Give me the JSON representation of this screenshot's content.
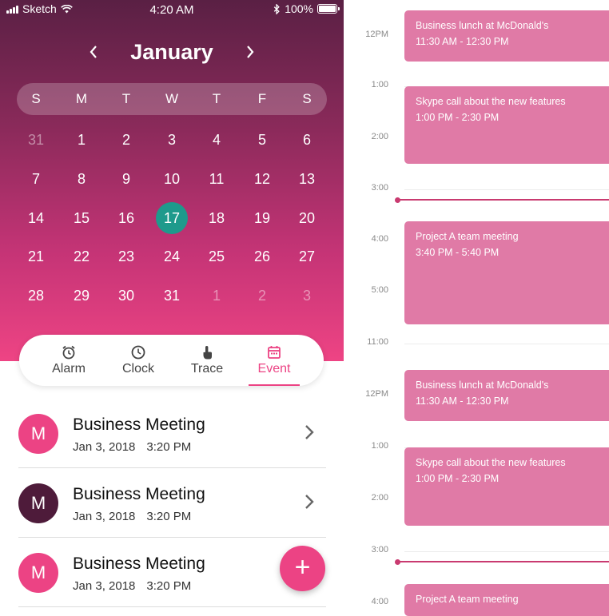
{
  "status_bar": {
    "carrier": "Sketch",
    "time": "4:20 AM",
    "battery": "100%"
  },
  "calendar": {
    "month": "January",
    "weekdays": [
      "S",
      "M",
      "T",
      "W",
      "T",
      "F",
      "S"
    ],
    "weeks": [
      [
        {
          "d": "31",
          "muted": true
        },
        {
          "d": "1"
        },
        {
          "d": "2"
        },
        {
          "d": "3"
        },
        {
          "d": "4"
        },
        {
          "d": "5"
        },
        {
          "d": "6"
        }
      ],
      [
        {
          "d": "7"
        },
        {
          "d": "8"
        },
        {
          "d": "9"
        },
        {
          "d": "10"
        },
        {
          "d": "11"
        },
        {
          "d": "12"
        },
        {
          "d": "13"
        }
      ],
      [
        {
          "d": "14"
        },
        {
          "d": "15"
        },
        {
          "d": "16"
        },
        {
          "d": "17",
          "selected": true
        },
        {
          "d": "18"
        },
        {
          "d": "19"
        },
        {
          "d": "20"
        }
      ],
      [
        {
          "d": "21"
        },
        {
          "d": "22"
        },
        {
          "d": "23"
        },
        {
          "d": "24"
        },
        {
          "d": "25"
        },
        {
          "d": "26"
        },
        {
          "d": "27"
        }
      ],
      [
        {
          "d": "28"
        },
        {
          "d": "29"
        },
        {
          "d": "30"
        },
        {
          "d": "31"
        },
        {
          "d": "1",
          "muted": true
        },
        {
          "d": "2",
          "muted": true
        },
        {
          "d": "3",
          "muted": true
        }
      ]
    ],
    "selected_color": "#1e9a8c"
  },
  "tabs": [
    {
      "label": "Alarm",
      "icon": "alarm-icon"
    },
    {
      "label": "Clock",
      "icon": "clock-icon"
    },
    {
      "label": "Trace",
      "icon": "touch-icon"
    },
    {
      "label": "Event",
      "icon": "calendar-icon",
      "active": true
    }
  ],
  "events_list": [
    {
      "initial": "M",
      "title": "Business Meeting",
      "date": "Jan 3, 2018",
      "time": "3:20 PM",
      "color": "#ec4384",
      "chevron": true
    },
    {
      "initial": "M",
      "title": "Business Meeting",
      "date": "Jan 3, 2018",
      "time": "3:20 PM",
      "color": "#4e1b3a",
      "chevron": true
    },
    {
      "initial": "M",
      "title": "Business Meeting",
      "date": "Jan 3, 2018",
      "time": "3:20 PM",
      "color": "#ec4384",
      "chevron": false
    }
  ],
  "fab": {
    "label": "+"
  },
  "timeline": {
    "hours": [
      "12PM",
      "1:00",
      "2:00",
      "3:00",
      "4:00",
      "5:00",
      "11:00",
      "12PM",
      "1:00",
      "2:00",
      "3:00",
      "4:00"
    ],
    "events": [
      {
        "title": "Business lunch at McDonald's",
        "time": "11:30 AM - 12:30 PM"
      },
      {
        "title": "Skype call about the new features",
        "time": "1:00 PM - 2:30 PM"
      },
      {
        "title": "Project A team meeting",
        "time": "3:40 PM - 5:40 PM"
      },
      {
        "title": "Business lunch at McDonald's",
        "time": "11:30 AM - 12:30 PM"
      },
      {
        "title": "Skype call about the new features",
        "time": "1:00 PM - 2:30 PM"
      },
      {
        "title": "Project A team meeting",
        "time": ""
      }
    ],
    "accent": "#c93a70",
    "event_color": "#e07aa6"
  }
}
